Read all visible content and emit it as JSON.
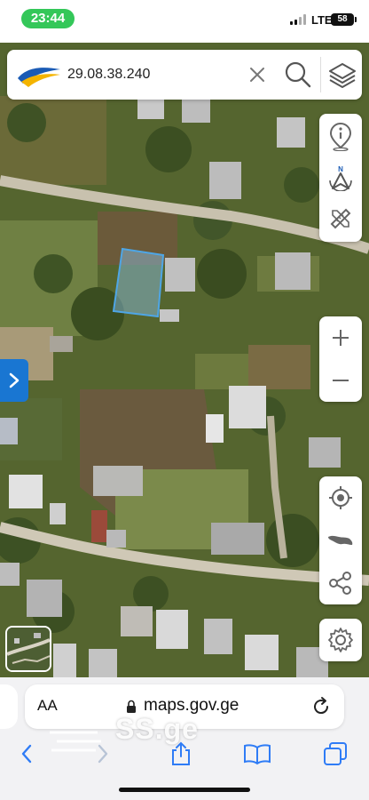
{
  "status_bar": {
    "time": "23:44",
    "network": "LTE",
    "battery": "58"
  },
  "search": {
    "value": "29.08.38.240",
    "placeholder": ""
  },
  "icons": {
    "logo": "napr-logo",
    "clear": "close-icon",
    "search": "search-icon",
    "layers": "layers-icon",
    "info": "info-location-icon",
    "compass": "compass-icon",
    "tools": "ruler-pencil-icon",
    "zoom_in": "plus-icon",
    "zoom_out": "minus-icon",
    "locate": "crosshair-icon",
    "region": "georgia-map-icon",
    "share": "share-icon",
    "settings": "gear-icon",
    "side_panel": "chevron-right-icon"
  },
  "colors": {
    "status_pill": "#34c759",
    "side_tab": "#1976d2",
    "parcel": "#4ea6e6"
  },
  "browser": {
    "text_size_label": "AA",
    "domain": "maps.gov.ge",
    "watermark": "SS.ge"
  }
}
